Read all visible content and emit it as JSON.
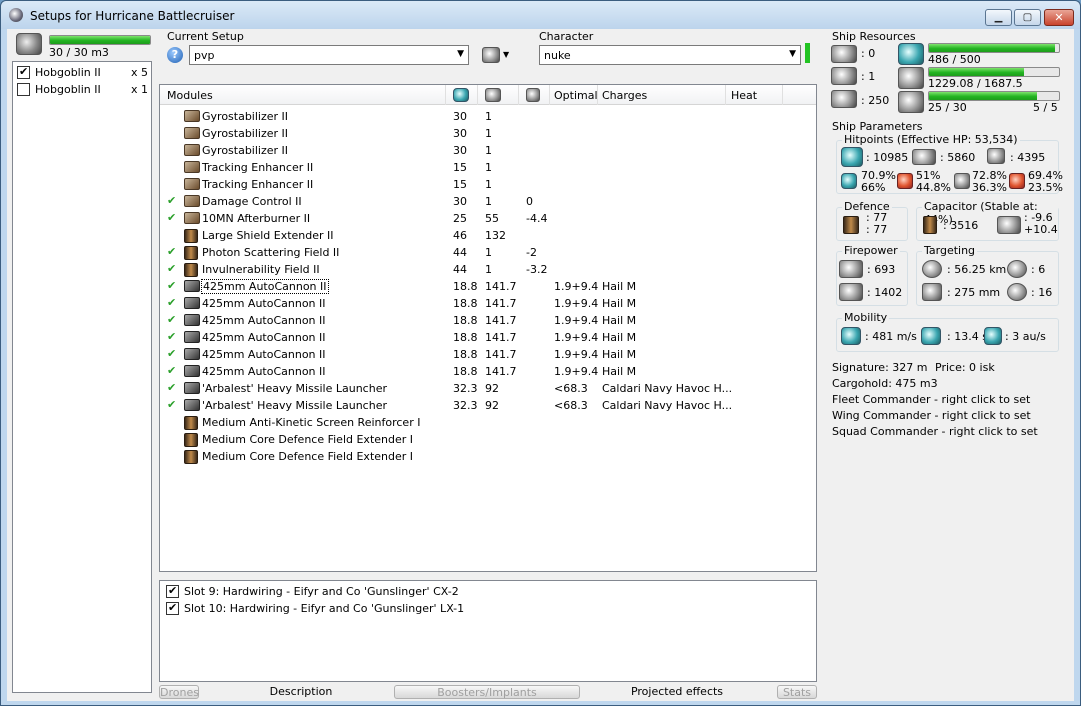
{
  "window": {
    "title": "Setups for Hurricane Battlecruiser"
  },
  "colors": {
    "bar_fill": "#23b422",
    "window_frame": "#bfd7ee",
    "check_green": "#2aa02a"
  },
  "drones_panel": {
    "bay": {
      "text": "30 / 30 m3",
      "fill_fraction": 1.0
    },
    "items": [
      {
        "label": "Hobgoblin II",
        "count": "x 5",
        "checked": true
      },
      {
        "label": "Hobgoblin II",
        "count": "x 1",
        "checked": false
      }
    ]
  },
  "current_setup": {
    "label": "Current Setup",
    "value": "pvp",
    "help_icon": "question-icon"
  },
  "character": {
    "label": "Character",
    "value": "nuke"
  },
  "modules": {
    "columns": [
      "Modules",
      "Optimal",
      "Charges",
      "Heat"
    ],
    "rows": [
      {
        "active": false,
        "icon": "module",
        "name": "Gyrostabilizer II",
        "c1": "30",
        "c2": "1",
        "c3": "",
        "optimal": "",
        "charges": ""
      },
      {
        "active": false,
        "icon": "module",
        "name": "Gyrostabilizer II",
        "c1": "30",
        "c2": "1",
        "c3": "",
        "optimal": "",
        "charges": ""
      },
      {
        "active": false,
        "icon": "module",
        "name": "Gyrostabilizer II",
        "c1": "30",
        "c2": "1",
        "c3": "",
        "optimal": "",
        "charges": ""
      },
      {
        "active": false,
        "icon": "module",
        "name": "Tracking Enhancer II",
        "c1": "15",
        "c2": "1",
        "c3": "",
        "optimal": "",
        "charges": ""
      },
      {
        "active": false,
        "icon": "module",
        "name": "Tracking Enhancer II",
        "c1": "15",
        "c2": "1",
        "c3": "",
        "optimal": "",
        "charges": ""
      },
      {
        "active": true,
        "icon": "module",
        "name": "Damage Control II",
        "c1": "30",
        "c2": "1",
        "c3": "0",
        "optimal": "",
        "charges": ""
      },
      {
        "active": true,
        "icon": "module",
        "name": "10MN Afterburner II",
        "c1": "25",
        "c2": "55",
        "c3": "-4.4",
        "optimal": "",
        "charges": ""
      },
      {
        "active": false,
        "icon": "shield",
        "name": "Large Shield Extender II",
        "c1": "46",
        "c2": "132",
        "c3": "",
        "optimal": "",
        "charges": ""
      },
      {
        "active": true,
        "icon": "shield",
        "name": "Photon Scattering Field II",
        "c1": "44",
        "c2": "1",
        "c3": "-2",
        "optimal": "",
        "charges": ""
      },
      {
        "active": true,
        "icon": "shield",
        "name": "Invulnerability Field II",
        "c1": "44",
        "c2": "1",
        "c3": "-3.2",
        "optimal": "",
        "charges": ""
      },
      {
        "active": true,
        "icon": "gun",
        "name": "425mm AutoCannon II",
        "c1": "18.8",
        "c2": "141.7",
        "c3": "",
        "optimal": "1.9+9.4",
        "charges": "Hail M",
        "focused": true
      },
      {
        "active": true,
        "icon": "gun",
        "name": "425mm AutoCannon II",
        "c1": "18.8",
        "c2": "141.7",
        "c3": "",
        "optimal": "1.9+9.4",
        "charges": "Hail M"
      },
      {
        "active": true,
        "icon": "gun",
        "name": "425mm AutoCannon II",
        "c1": "18.8",
        "c2": "141.7",
        "c3": "",
        "optimal": "1.9+9.4",
        "charges": "Hail M"
      },
      {
        "active": true,
        "icon": "gun",
        "name": "425mm AutoCannon II",
        "c1": "18.8",
        "c2": "141.7",
        "c3": "",
        "optimal": "1.9+9.4",
        "charges": "Hail M"
      },
      {
        "active": true,
        "icon": "gun",
        "name": "425mm AutoCannon II",
        "c1": "18.8",
        "c2": "141.7",
        "c3": "",
        "optimal": "1.9+9.4",
        "charges": "Hail M"
      },
      {
        "active": true,
        "icon": "gun",
        "name": "425mm AutoCannon II",
        "c1": "18.8",
        "c2": "141.7",
        "c3": "",
        "optimal": "1.9+9.4",
        "charges": "Hail M"
      },
      {
        "active": true,
        "icon": "gun",
        "name": "'Arbalest' Heavy Missile Launcher",
        "c1": "32.3",
        "c2": "92",
        "c3": "",
        "optimal": "<68.3",
        "charges": "Caldari Navy Havoc H..."
      },
      {
        "active": true,
        "icon": "gun",
        "name": "'Arbalest' Heavy Missile Launcher",
        "c1": "32.3",
        "c2": "92",
        "c3": "",
        "optimal": "<68.3",
        "charges": "Caldari Navy Havoc H..."
      },
      {
        "active": false,
        "icon": "shield",
        "name": "Medium Anti-Kinetic Screen Reinforcer I",
        "c1": "",
        "c2": "",
        "c3": "",
        "optimal": "",
        "charges": ""
      },
      {
        "active": false,
        "icon": "shield",
        "name": "Medium Core Defence Field Extender I",
        "c1": "",
        "c2": "",
        "c3": "",
        "optimal": "",
        "charges": ""
      },
      {
        "active": false,
        "icon": "shield",
        "name": "Medium Core Defence Field Extender I",
        "c1": "",
        "c2": "",
        "c3": "",
        "optimal": "",
        "charges": ""
      }
    ]
  },
  "implants": [
    {
      "label": "Slot 9: Hardwiring - Eifyr and Co 'Gunslinger' CX-2",
      "checked": true
    },
    {
      "label": "Slot 10: Hardwiring - Eifyr and Co 'Gunslinger' LX-1",
      "checked": true
    }
  ],
  "tabs": [
    {
      "label": "Drones",
      "enabled": false
    },
    {
      "label": "Description",
      "enabled": true
    },
    {
      "label": "Boosters/Implants",
      "enabled": false
    },
    {
      "label": "Projected effects",
      "enabled": true
    },
    {
      "label": "Stats",
      "enabled": false
    }
  ],
  "ship_resources": {
    "label": "Ship Resources",
    "left": [
      {
        "icon": "turret-hardpoint-icon",
        "value": ": 0"
      },
      {
        "icon": "launcher-hardpoint-icon",
        "value": ": 1"
      },
      {
        "icon": "drone-bandwidth-icon",
        "value": ": 250"
      }
    ],
    "bars": [
      {
        "icon": "cpu-icon",
        "text": "486 / 500",
        "fill_fraction": 0.972,
        "right": ""
      },
      {
        "icon": "powergrid-icon",
        "text": "1229.08 / 1687.5",
        "fill_fraction": 0.728,
        "right": ""
      },
      {
        "icon": "calibration-icon",
        "text": "25 / 30",
        "fill_fraction": 0.833,
        "right": "5 / 5"
      }
    ]
  },
  "ship_parameters": {
    "label": "Ship Parameters",
    "hitpoints": {
      "label": "Hitpoints (Effective HP: 53,534)",
      "shield": ": 10985",
      "armor": ": 5860",
      "structure": ": 4395",
      "resists": [
        {
          "icon": "em-resist-icon",
          "top": "70.9%",
          "bottom": "66%"
        },
        {
          "icon": "thermal-resist-icon",
          "top": "51%",
          "bottom": "44.8%"
        },
        {
          "icon": "kinetic-resist-icon",
          "top": "72.8%",
          "bottom": "36.3%"
        },
        {
          "icon": "explosive-resist-icon",
          "top": "69.4%",
          "bottom": "23.5%"
        }
      ]
    },
    "defence": {
      "label": "Defence",
      "top": ": 77",
      "bottom": ": 77"
    },
    "capacitor": {
      "label": "Capacitor (Stable at: 44%)",
      "capacity": ": 3516",
      "delta_top": ": -9.6",
      "delta_bottom": "+10.4"
    },
    "firepower": {
      "label": "Firepower",
      "turret": ": 693",
      "volley": ": 1402"
    },
    "targeting": {
      "label": "Targeting",
      "range": ": 56.25 km",
      "targets": ": 6",
      "resolution": ": 275 mm",
      "sensor": ": 16"
    },
    "mobility": {
      "label": "Mobility",
      "speed": ": 481 m/s",
      "align": ": 13.4 s",
      "warp": ": 3 au/s"
    }
  },
  "info": {
    "signature": "Signature: 327 m",
    "price": "Price: 0 isk",
    "cargohold": "Cargohold: 475 m3",
    "fleet": "Fleet Commander - right click to set",
    "wing": "Wing Commander - right click to set",
    "squad": "Squad Commander - right click to set"
  }
}
